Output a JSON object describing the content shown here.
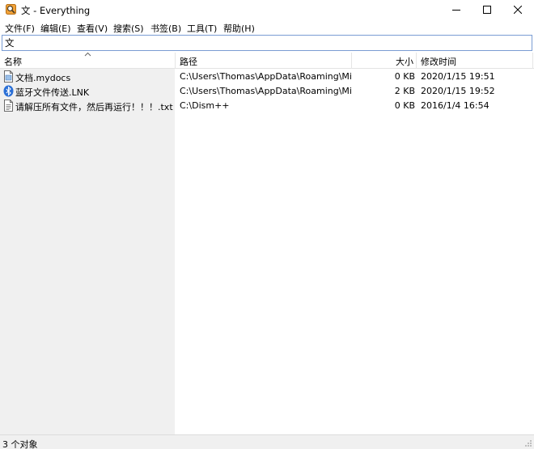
{
  "window": {
    "title": "文 - Everything",
    "icon": "everything-magnifier-icon"
  },
  "menu": [
    "文件(F)",
    "编辑(E)",
    "查看(V)",
    "搜索(S)",
    "书签(B)",
    "工具(T)",
    "帮助(H)"
  ],
  "search": {
    "value": "文",
    "placeholder": ""
  },
  "columns": {
    "name": "名称",
    "path": "路径",
    "size": "大小",
    "date": "修改时间"
  },
  "rows": [
    {
      "name": "文档.mydocs",
      "path": "C:\\Users\\Thomas\\AppData\\Roaming\\Mic...",
      "size": "0 KB",
      "date": "2020/1/15 19:51",
      "icon": "document-file-icon"
    },
    {
      "name": "蓝牙文件传送.LNK",
      "path": "C:\\Users\\Thomas\\AppData\\Roaming\\Mic...",
      "size": "2 KB",
      "date": "2020/1/15 19:52",
      "icon": "bluetooth-icon"
    },
    {
      "name": "请解压所有文件，然后再运行！！！.txt",
      "path": "C:\\Dism++",
      "size": "0 KB",
      "date": "2016/1/4 16:54",
      "icon": "text-file-icon"
    }
  ],
  "status": {
    "text": "3 个对象"
  },
  "colors": {
    "search_border": "#7a9cd3",
    "name_pane_bg": "#f0f0f0",
    "bluetooth": "#2a6fd6"
  }
}
